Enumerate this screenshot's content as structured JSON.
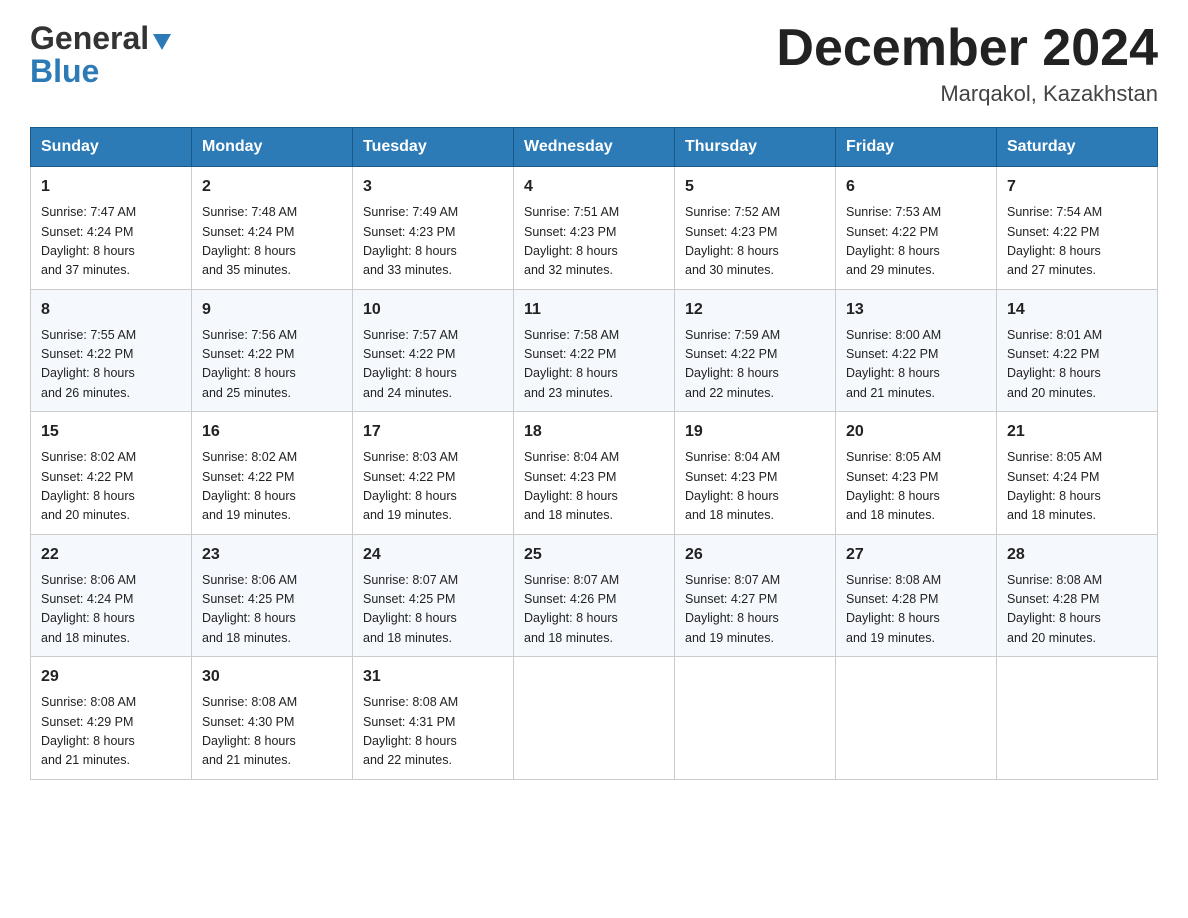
{
  "header": {
    "logo_line1": "General",
    "logo_line2": "Blue",
    "month_title": "December 2024",
    "location": "Marqakol, Kazakhstan"
  },
  "days_of_week": [
    "Sunday",
    "Monday",
    "Tuesday",
    "Wednesday",
    "Thursday",
    "Friday",
    "Saturday"
  ],
  "weeks": [
    [
      {
        "day": "1",
        "sunrise": "7:47 AM",
        "sunset": "4:24 PM",
        "daylight": "8 hours and 37 minutes."
      },
      {
        "day": "2",
        "sunrise": "7:48 AM",
        "sunset": "4:24 PM",
        "daylight": "8 hours and 35 minutes."
      },
      {
        "day": "3",
        "sunrise": "7:49 AM",
        "sunset": "4:23 PM",
        "daylight": "8 hours and 33 minutes."
      },
      {
        "day": "4",
        "sunrise": "7:51 AM",
        "sunset": "4:23 PM",
        "daylight": "8 hours and 32 minutes."
      },
      {
        "day": "5",
        "sunrise": "7:52 AM",
        "sunset": "4:23 PM",
        "daylight": "8 hours and 30 minutes."
      },
      {
        "day": "6",
        "sunrise": "7:53 AM",
        "sunset": "4:22 PM",
        "daylight": "8 hours and 29 minutes."
      },
      {
        "day": "7",
        "sunrise": "7:54 AM",
        "sunset": "4:22 PM",
        "daylight": "8 hours and 27 minutes."
      }
    ],
    [
      {
        "day": "8",
        "sunrise": "7:55 AM",
        "sunset": "4:22 PM",
        "daylight": "8 hours and 26 minutes."
      },
      {
        "day": "9",
        "sunrise": "7:56 AM",
        "sunset": "4:22 PM",
        "daylight": "8 hours and 25 minutes."
      },
      {
        "day": "10",
        "sunrise": "7:57 AM",
        "sunset": "4:22 PM",
        "daylight": "8 hours and 24 minutes."
      },
      {
        "day": "11",
        "sunrise": "7:58 AM",
        "sunset": "4:22 PM",
        "daylight": "8 hours and 23 minutes."
      },
      {
        "day": "12",
        "sunrise": "7:59 AM",
        "sunset": "4:22 PM",
        "daylight": "8 hours and 22 minutes."
      },
      {
        "day": "13",
        "sunrise": "8:00 AM",
        "sunset": "4:22 PM",
        "daylight": "8 hours and 21 minutes."
      },
      {
        "day": "14",
        "sunrise": "8:01 AM",
        "sunset": "4:22 PM",
        "daylight": "8 hours and 20 minutes."
      }
    ],
    [
      {
        "day": "15",
        "sunrise": "8:02 AM",
        "sunset": "4:22 PM",
        "daylight": "8 hours and 20 minutes."
      },
      {
        "day": "16",
        "sunrise": "8:02 AM",
        "sunset": "4:22 PM",
        "daylight": "8 hours and 19 minutes."
      },
      {
        "day": "17",
        "sunrise": "8:03 AM",
        "sunset": "4:22 PM",
        "daylight": "8 hours and 19 minutes."
      },
      {
        "day": "18",
        "sunrise": "8:04 AM",
        "sunset": "4:23 PM",
        "daylight": "8 hours and 18 minutes."
      },
      {
        "day": "19",
        "sunrise": "8:04 AM",
        "sunset": "4:23 PM",
        "daylight": "8 hours and 18 minutes."
      },
      {
        "day": "20",
        "sunrise": "8:05 AM",
        "sunset": "4:23 PM",
        "daylight": "8 hours and 18 minutes."
      },
      {
        "day": "21",
        "sunrise": "8:05 AM",
        "sunset": "4:24 PM",
        "daylight": "8 hours and 18 minutes."
      }
    ],
    [
      {
        "day": "22",
        "sunrise": "8:06 AM",
        "sunset": "4:24 PM",
        "daylight": "8 hours and 18 minutes."
      },
      {
        "day": "23",
        "sunrise": "8:06 AM",
        "sunset": "4:25 PM",
        "daylight": "8 hours and 18 minutes."
      },
      {
        "day": "24",
        "sunrise": "8:07 AM",
        "sunset": "4:25 PM",
        "daylight": "8 hours and 18 minutes."
      },
      {
        "day": "25",
        "sunrise": "8:07 AM",
        "sunset": "4:26 PM",
        "daylight": "8 hours and 18 minutes."
      },
      {
        "day": "26",
        "sunrise": "8:07 AM",
        "sunset": "4:27 PM",
        "daylight": "8 hours and 19 minutes."
      },
      {
        "day": "27",
        "sunrise": "8:08 AM",
        "sunset": "4:28 PM",
        "daylight": "8 hours and 19 minutes."
      },
      {
        "day": "28",
        "sunrise": "8:08 AM",
        "sunset": "4:28 PM",
        "daylight": "8 hours and 20 minutes."
      }
    ],
    [
      {
        "day": "29",
        "sunrise": "8:08 AM",
        "sunset": "4:29 PM",
        "daylight": "8 hours and 21 minutes."
      },
      {
        "day": "30",
        "sunrise": "8:08 AM",
        "sunset": "4:30 PM",
        "daylight": "8 hours and 21 minutes."
      },
      {
        "day": "31",
        "sunrise": "8:08 AM",
        "sunset": "4:31 PM",
        "daylight": "8 hours and 22 minutes."
      },
      null,
      null,
      null,
      null
    ]
  ],
  "labels": {
    "sunrise": "Sunrise:",
    "sunset": "Sunset:",
    "daylight": "Daylight:"
  }
}
